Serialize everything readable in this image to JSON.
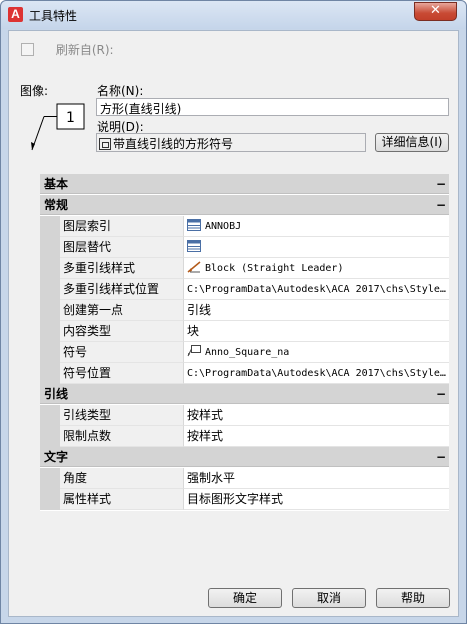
{
  "window": {
    "title": "工具特性",
    "close_label": "✕"
  },
  "refresh": {
    "label": "刷新自(R):"
  },
  "image": {
    "label": "图像:",
    "preview_number": "1"
  },
  "name": {
    "label": "名称(N):",
    "value": "方形(直线引线)"
  },
  "description": {
    "label": "说明(D):",
    "value": "带直线引线的方形符号"
  },
  "details_button": "详细信息(I)",
  "grid": {
    "collapse_symbol": "−",
    "basic": "基本",
    "general": {
      "title": "常规",
      "rows": [
        {
          "name": "图层索引",
          "value": "ANNOBJ",
          "icon": "layer-table-icon"
        },
        {
          "name": "图层替代",
          "value": "",
          "icon": "layer-table-icon"
        },
        {
          "name": "多重引线样式",
          "value": "Block (Straight Leader)",
          "icon": "multileader-icon"
        },
        {
          "name": "多重引线样式位置",
          "value": "C:\\ProgramData\\Autodesk\\ACA  2017\\chs\\Styles\\…",
          "icon": ""
        },
        {
          "name": "创建第一点",
          "value": "引线",
          "icon": ""
        },
        {
          "name": "内容类型",
          "value": "块",
          "icon": ""
        },
        {
          "name": "符号",
          "value": "Anno_Square_na",
          "icon": "symbol-icon"
        },
        {
          "name": "符号位置",
          "value": "C:\\ProgramData\\Autodesk\\ACA  2017\\chs\\Styles\\…",
          "icon": ""
        }
      ]
    },
    "leader": {
      "title": "引线",
      "rows": [
        {
          "name": "引线类型",
          "value": "按样式"
        },
        {
          "name": "限制点数",
          "value": "按样式"
        }
      ]
    },
    "text": {
      "title": "文字",
      "rows": [
        {
          "name": "角度",
          "value": "强制水平"
        },
        {
          "name": "属性样式",
          "value": "目标图形文字样式"
        }
      ]
    }
  },
  "buttons": {
    "ok": "确定",
    "cancel": "取消",
    "help": "帮助"
  },
  "colors": {
    "frame": "#c7d6e9",
    "client": "#f0f0f0",
    "category": "#d4d4d4",
    "close": "#c84a34"
  }
}
